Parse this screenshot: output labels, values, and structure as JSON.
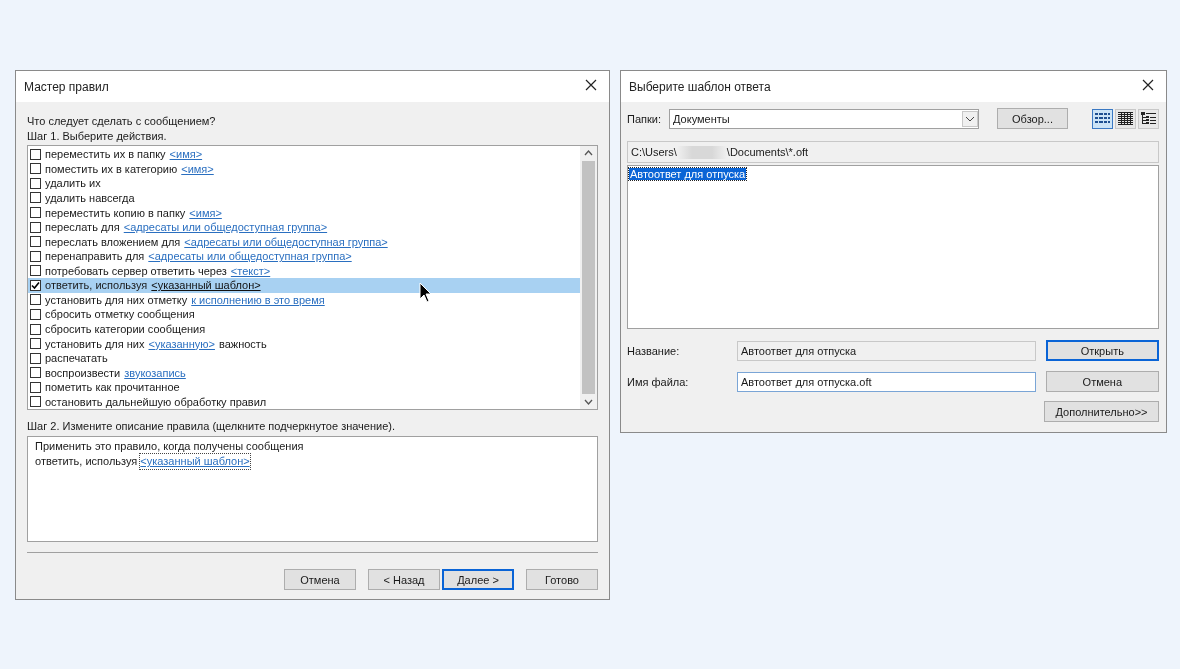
{
  "rules_wizard": {
    "title": "Мастер правил",
    "question": "Что следует сделать с сообщением?",
    "step1": "Шаг 1. Выберите действия.",
    "actions": [
      {
        "text": "переместить их в папку",
        "link": "<имя>",
        "checked": false,
        "selected": false
      },
      {
        "text": "поместить их в категорию",
        "link": "<имя>",
        "checked": false,
        "selected": false
      },
      {
        "text": "удалить их",
        "checked": false,
        "selected": false
      },
      {
        "text": "удалить навсегда",
        "checked": false,
        "selected": false
      },
      {
        "text": "переместить копию в папку",
        "link": "<имя>",
        "checked": false,
        "selected": false
      },
      {
        "text": "переслать для",
        "link": "<адресаты или общедоступная группа>",
        "checked": false,
        "selected": false
      },
      {
        "text": "переслать вложением для",
        "link": "<адресаты или общедоступная группа>",
        "checked": false,
        "selected": false
      },
      {
        "text": "перенаправить для",
        "link": "<адресаты или общедоступная группа>",
        "checked": false,
        "selected": false
      },
      {
        "text": "потребовать сервер ответить через",
        "link": "<текст>",
        "checked": false,
        "selected": false
      },
      {
        "text": "ответить, используя",
        "link": "<указанный шаблон>",
        "checked": true,
        "selected": true
      },
      {
        "text": "установить для них отметку",
        "link": "к исполнению в это время",
        "checked": false,
        "selected": false
      },
      {
        "text": "сбросить отметку сообщения",
        "checked": false,
        "selected": false
      },
      {
        "text": "сбросить категории сообщения",
        "checked": false,
        "selected": false
      },
      {
        "text": "установить для них",
        "link": "<указанную>",
        "suffix": "важность",
        "checked": false,
        "selected": false
      },
      {
        "text": "распечатать",
        "checked": false,
        "selected": false
      },
      {
        "text": "воспроизвести",
        "link": "звукозапись",
        "checked": false,
        "selected": false
      },
      {
        "text": "пометить как прочитанное",
        "checked": false,
        "selected": false
      },
      {
        "text": "остановить дальнейшую обработку правил",
        "checked": false,
        "selected": false
      }
    ],
    "step2": "Шаг 2. Измените описание правила (щелкните подчеркнутое значение).",
    "description": [
      {
        "text": "Применить это правило, когда получены сообщения"
      },
      {
        "text": "ответить, используя",
        "link": "<указанный шаблон>"
      }
    ],
    "buttons": [
      {
        "label": "Отмена",
        "default": false
      },
      {
        "label": "< Назад",
        "default": false
      },
      {
        "label": "Далее >",
        "default": true
      },
      {
        "label": "Готово",
        "default": false
      }
    ]
  },
  "template_dialog": {
    "title": "Выберите шаблон ответа",
    "folders_label": "Папки:",
    "folder": "Документы",
    "browse": "Обзор...",
    "views": [
      {
        "kind": "list",
        "selected": true
      },
      {
        "kind": "details",
        "selected": false
      },
      {
        "kind": "tree",
        "selected": false
      }
    ],
    "path_start": "C:\\Users\\",
    "path_end": "\\Documents\\*.oft",
    "files": [
      {
        "name": "Автоответ для отпуска",
        "selected": true
      }
    ],
    "name_label": "Название:",
    "name_value": "Автоответ для отпуска",
    "filename_label": "Имя файла:",
    "filename_value": "Автоответ для отпуска.oft",
    "buttons": [
      {
        "label": "Открыть",
        "default": true
      },
      {
        "label": "Отмена",
        "default": false
      },
      {
        "label": "Дополнительно>>",
        "default": false
      }
    ]
  }
}
